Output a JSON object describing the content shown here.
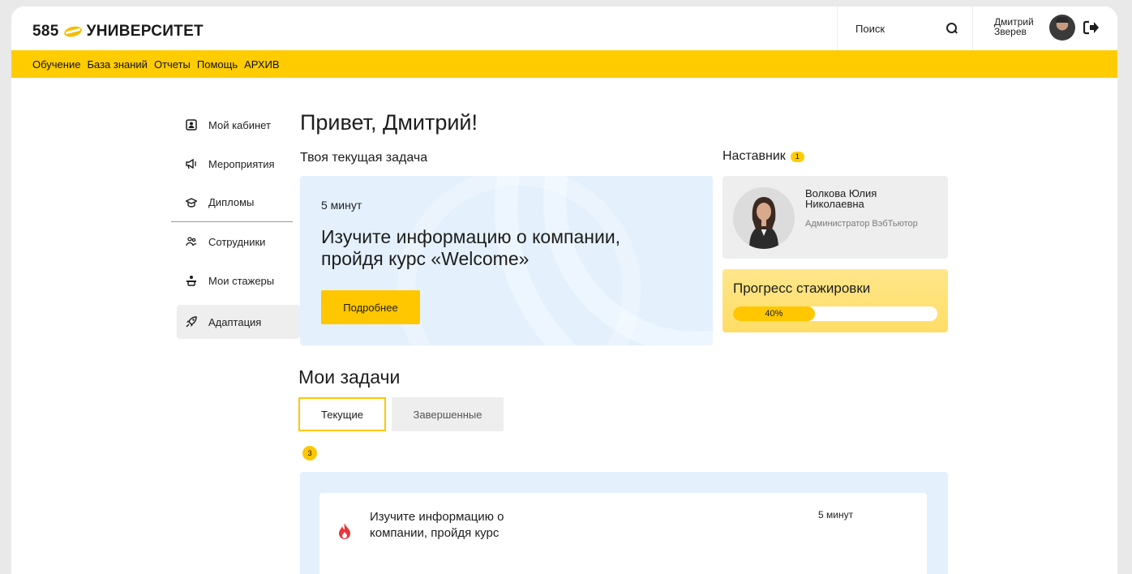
{
  "header": {
    "logo_number": "585",
    "logo_text": "УНИВЕРСИТЕТ",
    "search_placeholder": "Поиск",
    "user_first": "Дмитрий",
    "user_last": "Зверев"
  },
  "nav": {
    "items": [
      "Обучение",
      "База знаний",
      "Отчеты",
      "Помощь",
      "АРХИВ"
    ]
  },
  "sidebar": {
    "items": [
      {
        "label": "Мой кабинет",
        "icon": "profile-icon"
      },
      {
        "label": "Мероприятия",
        "icon": "megaphone-icon"
      },
      {
        "label": "Дипломы",
        "icon": "graduation-cap-icon"
      },
      {
        "label": "Сотрудники",
        "icon": "people-icon"
      },
      {
        "label": "Мои стажеры",
        "icon": "trainee-icon"
      },
      {
        "label": "Адаптация",
        "icon": "rocket-icon"
      }
    ]
  },
  "main": {
    "greeting": "Привет, Дмитрий!",
    "current_task_label": "Твоя текущая задача",
    "current_task": {
      "duration": "5 минут",
      "title": "Изучите информацию о компании, пройдя курс «Welcome»",
      "button": "Подробнее"
    },
    "mentor": {
      "label": "Наставник",
      "count": "1",
      "name": "Волкова Юлия Николаевна",
      "role": "Администратор ВэбТьютор"
    },
    "progress": {
      "title": "Прогресс стажировки",
      "value_label": "40%",
      "fraction": 0.4
    },
    "tasks": {
      "heading": "Мои задачи",
      "tab_current": "Текущие",
      "tab_done": "Завершенные",
      "count": "3",
      "items": [
        {
          "title": "Изучите информацию о компании, пройдя курс",
          "duration": "5 минут"
        }
      ]
    }
  },
  "colors": {
    "accent": "#ffcc00",
    "card_blue": "#e4f1fd"
  }
}
